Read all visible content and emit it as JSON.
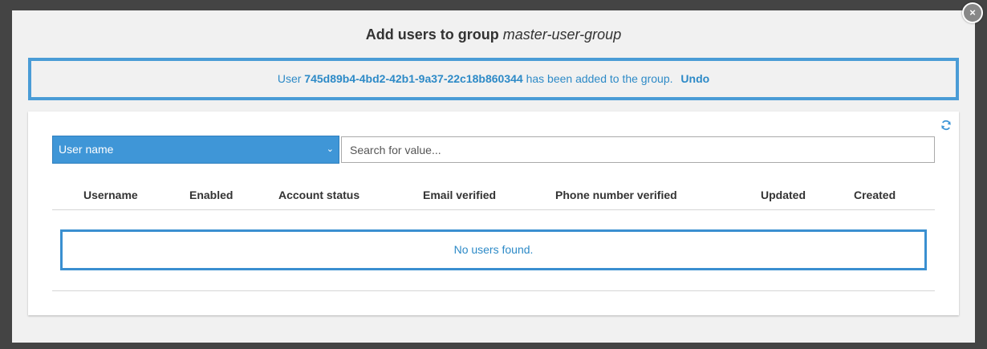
{
  "dialog": {
    "title_prefix": "Add users to group",
    "group_name": "master-user-group",
    "close_label": "×"
  },
  "notice": {
    "text_before": "User",
    "user_id": "745d89b4-4bd2-42b1-9a37-22c18b860344",
    "text_after": "has been added to the group.",
    "undo_label": "Undo"
  },
  "filter": {
    "attribute_selected": "User name",
    "search_placeholder": "Search for value...",
    "refresh_icon": "refresh-icon"
  },
  "table": {
    "columns": [
      "Username",
      "Enabled",
      "Account status",
      "Email verified",
      "Phone number verified",
      "Updated",
      "Created"
    ],
    "empty_message": "No users found."
  },
  "colors": {
    "accent": "#3f96d7",
    "notice_border": "#4a9cd6",
    "link_text": "#2d8ac7"
  }
}
